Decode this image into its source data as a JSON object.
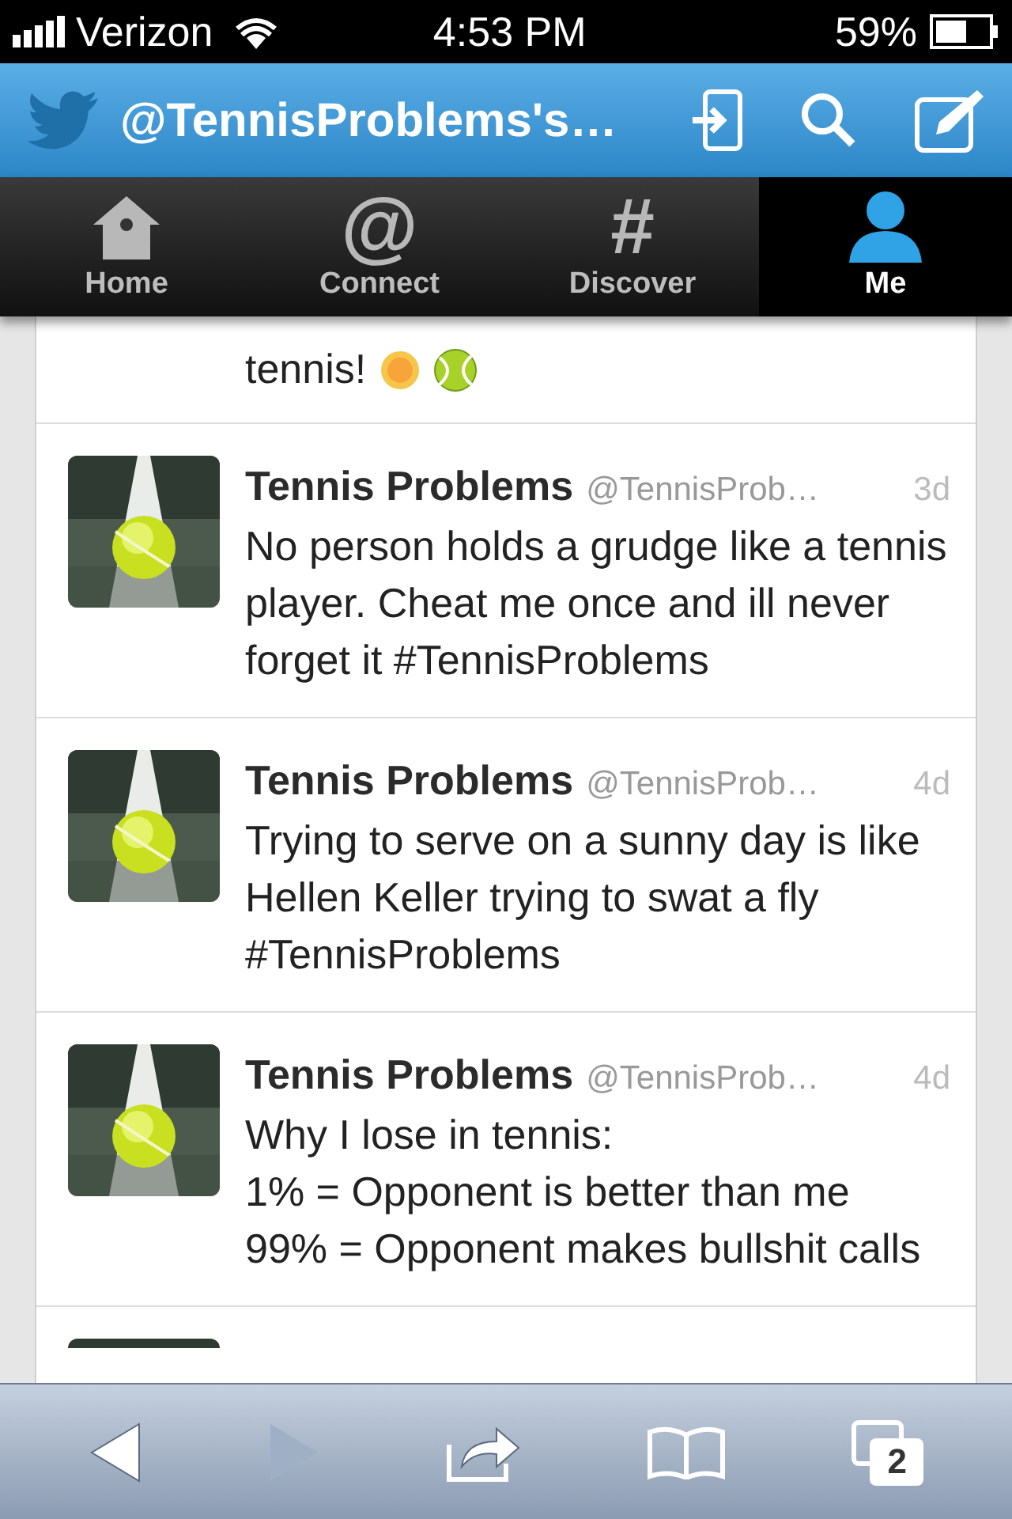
{
  "status_bar": {
    "carrier": "Verizon",
    "time": "4:53 PM",
    "battery": "59%"
  },
  "nav_bar": {
    "title": "@TennisProblems's…"
  },
  "tabs": [
    {
      "label": "Home",
      "kind": "house",
      "selected": false
    },
    {
      "label": "Connect",
      "kind": "glyph",
      "glyph": "@",
      "selected": false
    },
    {
      "label": "Discover",
      "kind": "glyph",
      "glyph": "#",
      "selected": false
    },
    {
      "label": "Me",
      "kind": "person",
      "selected": true
    }
  ],
  "partial_tweet": {
    "text": "tennis!"
  },
  "tweets": [
    {
      "name": "Tennis Problems",
      "handle": "@TennisProb…",
      "time": "3d",
      "text": "No person holds a grudge like a tennis player. Cheat me once and ill never forget it #TennisProblems"
    },
    {
      "name": "Tennis Problems",
      "handle": "@TennisProb…",
      "time": "4d",
      "text": "Trying to serve on a sunny day is like Hellen Keller trying to swat a fly #TennisProblems"
    },
    {
      "name": "Tennis Problems",
      "handle": "@TennisProb…",
      "time": "4d",
      "text": "Why I lose in tennis:\n1% = Opponent is better than me\n99% = Opponent makes bullshit calls"
    }
  ],
  "toolbar": {
    "forward_disabled": true,
    "tab_count": "2"
  }
}
